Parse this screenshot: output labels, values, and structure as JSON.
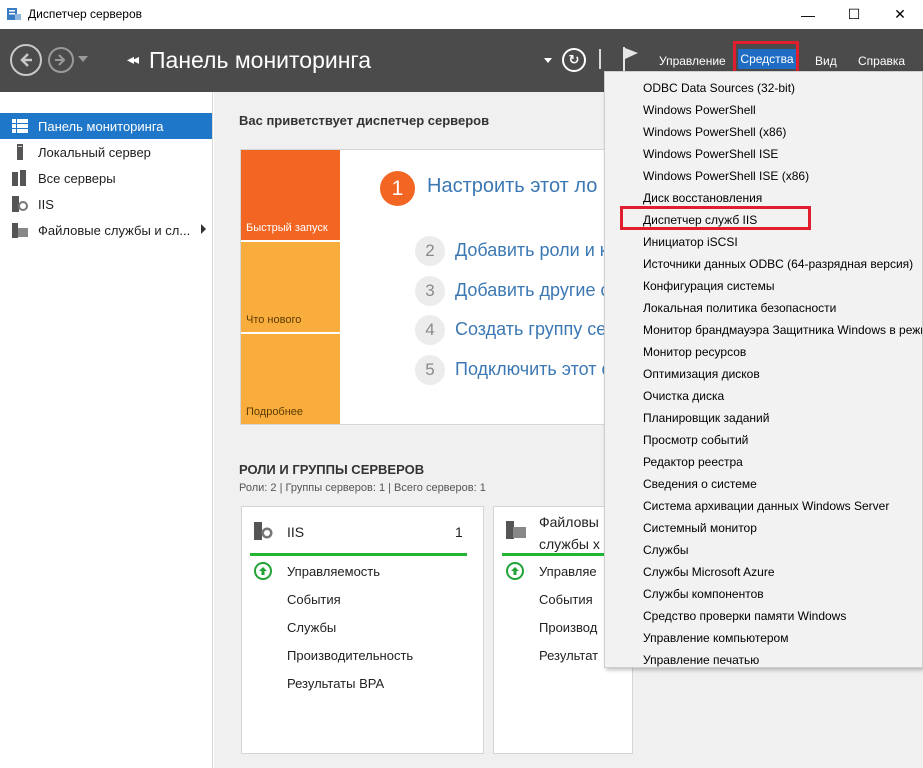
{
  "window": {
    "title": "Диспетчер серверов",
    "minimize_glyph": "—",
    "maximize_glyph": "☐",
    "close_glyph": "✕"
  },
  "header": {
    "breadcrumb_glyph": "◂◂",
    "page_title": "Панель мониторинга",
    "refresh_glyph": "↻",
    "menu": {
      "manage": "Управление",
      "tools": "Средства",
      "view": "Вид",
      "help": "Справка"
    }
  },
  "sidebar": {
    "items": [
      {
        "label": "Панель мониторинга",
        "icon": "dashboard-icon"
      },
      {
        "label": "Локальный сервер",
        "icon": "server-icon"
      },
      {
        "label": "Все серверы",
        "icon": "servers-icon"
      },
      {
        "label": "IIS",
        "icon": "iis-icon"
      },
      {
        "label": "Файловые службы и сл...",
        "icon": "file-services-icon"
      }
    ]
  },
  "main": {
    "welcome": "Вас приветствует диспетчер серверов",
    "tiles": [
      "Быстрый запуск",
      "Что нового",
      "Подробнее"
    ],
    "steps": [
      {
        "num": "1",
        "text": "Настроить этот ло"
      },
      {
        "num": "2",
        "text": "Добавить роли и к"
      },
      {
        "num": "3",
        "text": "Добавить другие с"
      },
      {
        "num": "4",
        "text": "Создать группу се"
      },
      {
        "num": "5",
        "text": "Подключить этот с"
      }
    ],
    "roles_title": "РОЛИ И ГРУППЫ СЕРВЕРОВ",
    "roles_sub": "Роли: 2 | Группы серверов: 1 | Всего серверов: 1",
    "cards": [
      {
        "title": "IIS",
        "count": "1",
        "lines": [
          "Управляемость",
          "События",
          "Службы",
          "Производительность",
          "Результаты BPA"
        ]
      },
      {
        "title_line1": "Файловы",
        "title_line2": "службы х",
        "lines": [
          "Управляе",
          "События",
          "Производ",
          "Результат"
        ]
      }
    ]
  },
  "tools_menu": {
    "items": [
      "ODBC Data Sources (32-bit)",
      "Windows PowerShell",
      "Windows PowerShell (x86)",
      "Windows PowerShell ISE",
      "Windows PowerShell ISE (x86)",
      "Диск восстановления",
      "Диспетчер служб IIS",
      "Инициатор iSCSI",
      "Источники данных ODBC (64-разрядная версия)",
      "Конфигурация системы",
      "Локальная политика безопасности",
      "Монитор брандмауэра Защитника Windows в режи",
      "Монитор ресурсов",
      "Оптимизация дисков",
      "Очистка диска",
      "Планировщик заданий",
      "Просмотр событий",
      "Редактор реестра",
      "Сведения о системе",
      "Система архивации данных Windows Server",
      "Системный монитор",
      "Службы",
      "Службы Microsoft Azure",
      "Службы компонентов",
      "Средство проверки памяти Windows",
      "Управление компьютером",
      "Управление печатью"
    ],
    "highlighted": "Диспетчер служб IIS"
  },
  "colors": {
    "header_bg": "#4b4b4b",
    "accent_blue": "#1f77c9",
    "highlight_red": "#e01e2e",
    "tile_orange": "#f26522",
    "tile_yellow": "#f9ad3c",
    "status_green": "#21b534"
  }
}
